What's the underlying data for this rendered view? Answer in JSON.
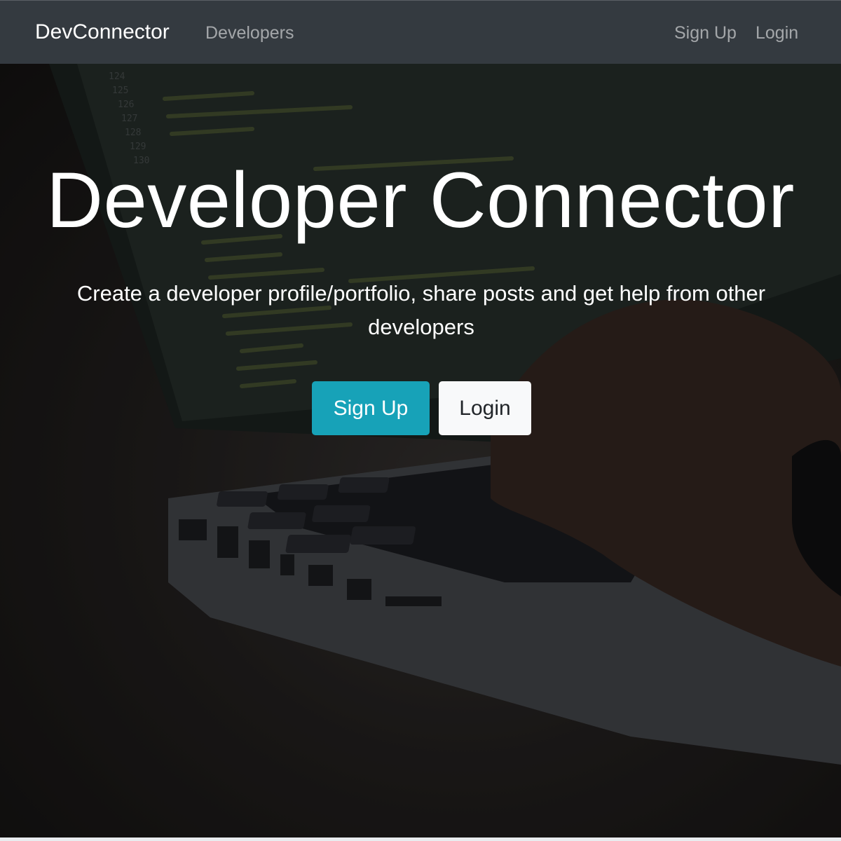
{
  "navbar": {
    "brand": "DevConnector",
    "links": {
      "developers": "Developers",
      "signup": "Sign Up",
      "login": "Login"
    }
  },
  "landing": {
    "title": "Developer Connector",
    "lead": "Create a developer profile/portfolio, share posts and get help from other developers",
    "buttons": {
      "signup": "Sign Up",
      "login": "Login"
    },
    "background_image": "laptop-code-photo"
  },
  "colors": {
    "navbar_bg": "#343a40",
    "primary": "#17a2b8",
    "light": "#f8f9fa",
    "nav_link": "rgba(255,255,255,0.55)"
  }
}
